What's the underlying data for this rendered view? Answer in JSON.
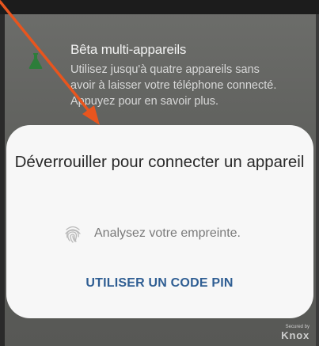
{
  "notification": {
    "icon": "flask-icon",
    "title": "Bêta multi-appareils",
    "body_lines": [
      "Utilisez jusqu'à quatre appareils sans",
      "avoir à laisser votre téléphone connecté.",
      "Appuyez pour en savoir plus."
    ]
  },
  "dialog": {
    "title": "Déverrouiller pour connecter un appareil",
    "fingerprint_icon": "fingerprint-icon",
    "fingerprint_prompt": "Analysez votre empreinte.",
    "pin_button_label": "UTILISER UN CODE PIN"
  },
  "badge": {
    "secured_by": "Secured by",
    "brand": "Knox"
  },
  "annotation": {
    "arrow_color": "#e8551e"
  },
  "colors": {
    "background": "#636461",
    "dialog": "#f7f7f7",
    "accent": "#2f5e93"
  }
}
